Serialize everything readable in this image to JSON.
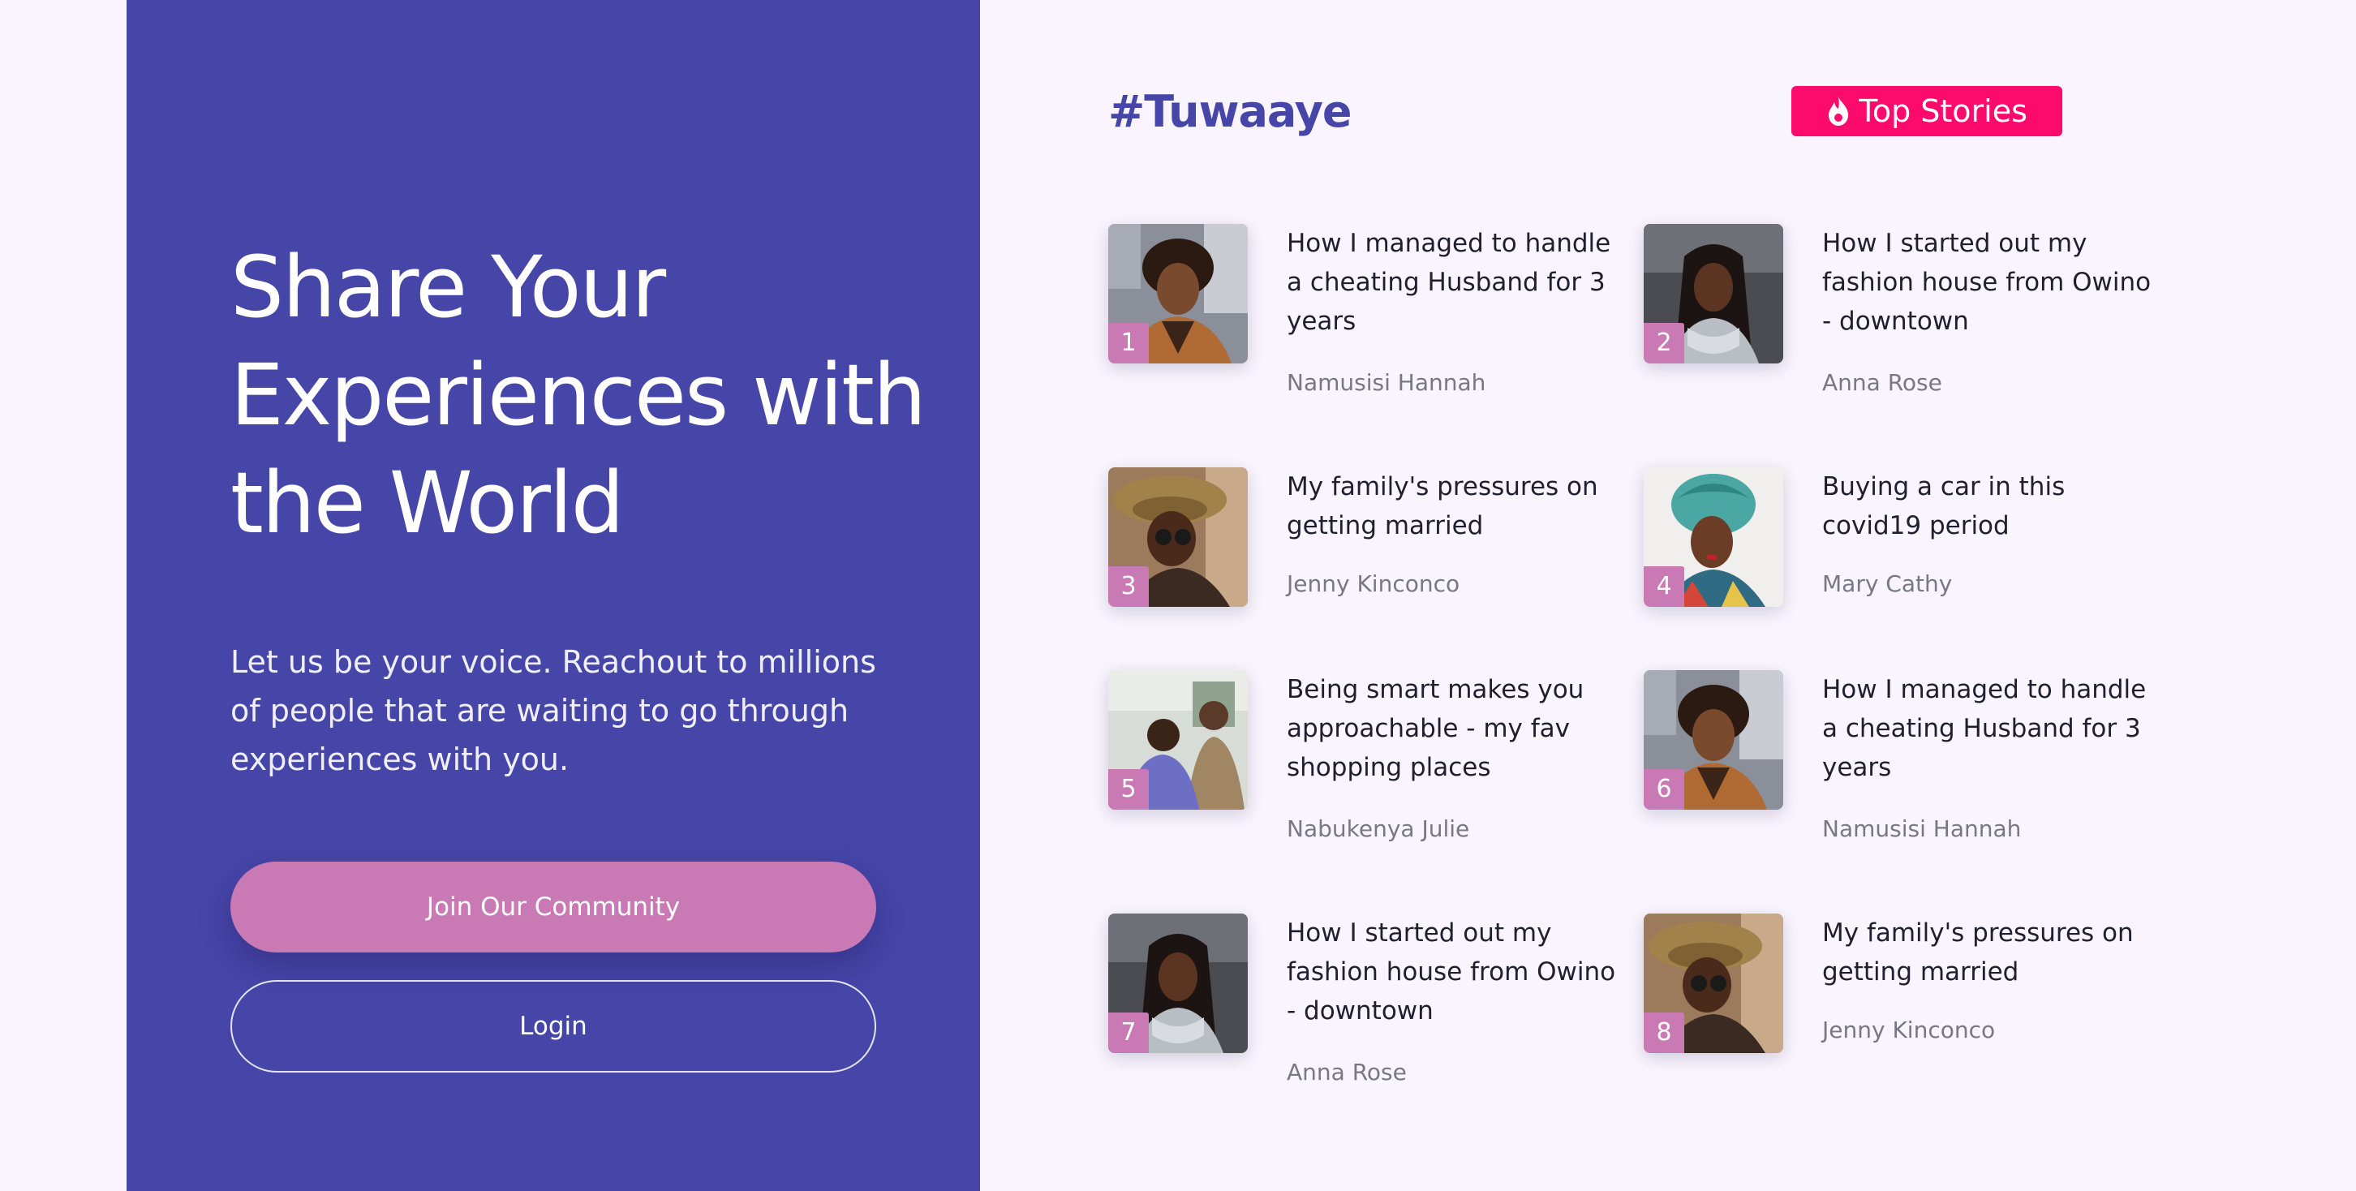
{
  "hero": {
    "title": "Share Your Experiences with the World",
    "subtitle": "Let us be your voice. Reachout to millions of people that are waiting to go through experiences with you.",
    "join_label": "Join Our Community",
    "login_label": "Login"
  },
  "header": {
    "brand": "#Tuwaaye",
    "badge_label": "Top Stories",
    "badge_icon": "flame-icon"
  },
  "colors": {
    "primary": "#4646a8",
    "accent": "#c97ab4",
    "badge": "#fc0a6c",
    "background": "#f9f4fd"
  },
  "stories": [
    {
      "rank": "1",
      "title": "How I managed to handle a cheating Husband for 3 years",
      "author": "Namusisi Hannah"
    },
    {
      "rank": "2",
      "title": "How I started out my fashion house from Owino - downtown",
      "author": "Anna Rose"
    },
    {
      "rank": "3",
      "title": "My family's pressures on getting married",
      "author": "Jenny Kinconco"
    },
    {
      "rank": "4",
      "title": "Buying a car in this covid19 period",
      "author": "Mary Cathy"
    },
    {
      "rank": "5",
      "title": "Being smart makes you approachable - my fav shopping places",
      "author": "Nabukenya Julie"
    },
    {
      "rank": "6",
      "title": "How I managed to handle a cheating Husband for 3 years",
      "author": "Namusisi Hannah"
    },
    {
      "rank": "7",
      "title": "How I started out my fashion house from Owino - downtown",
      "author": "Anna Rose"
    },
    {
      "rank": "8",
      "title": "My family's pressures on getting married",
      "author": "Jenny Kinconco"
    }
  ]
}
